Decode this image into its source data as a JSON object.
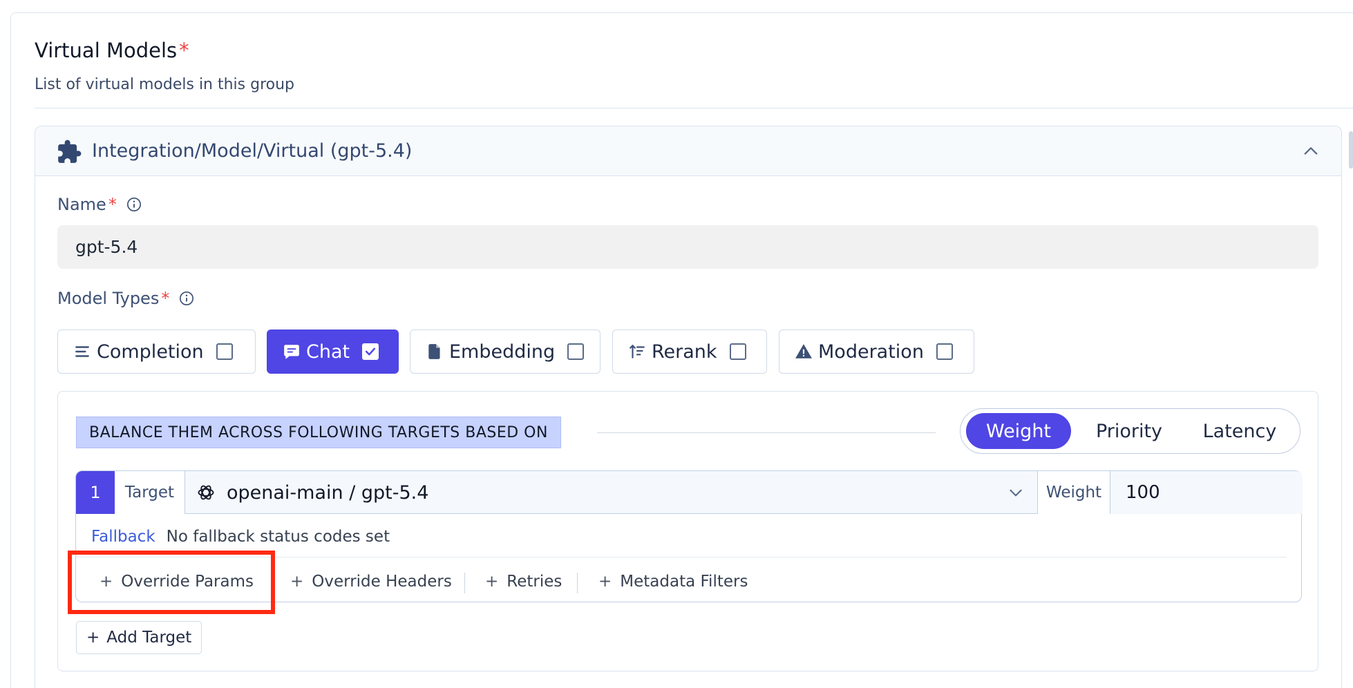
{
  "section": {
    "title": "Virtual Models",
    "required_mark": "*",
    "subtitle": "List of virtual models in this group"
  },
  "accordion": {
    "title": "Integration/Model/Virtual (gpt-5.4)",
    "icon": "puzzle-icon",
    "toggle_icon": "chevron-up-icon"
  },
  "name_field": {
    "label": "Name",
    "required_mark": "*",
    "value": "gpt-5.4"
  },
  "model_types": {
    "label": "Model Types",
    "required_mark": "*",
    "options": [
      {
        "label": "Completion",
        "icon": "lines-icon",
        "checked": false
      },
      {
        "label": "Chat",
        "icon": "chat-icon",
        "checked": true
      },
      {
        "label": "Embedding",
        "icon": "document-icon",
        "checked": false
      },
      {
        "label": "Rerank",
        "icon": "sort-icon",
        "checked": false
      },
      {
        "label": "Moderation",
        "icon": "warning-icon",
        "checked": false
      }
    ]
  },
  "balance": {
    "label": "BALANCE THEM ACROSS FOLLOWING TARGETS BASED ON",
    "strategies": [
      "Weight",
      "Priority",
      "Latency"
    ],
    "selected": "Weight"
  },
  "target": {
    "index": "1",
    "tag": "Target",
    "model": "openai-main / gpt-5.4",
    "weight_label": "Weight",
    "weight_value": "100",
    "fallback_label": "Fallback",
    "fallback_text": "No fallback status codes set",
    "actions": [
      "Override Params",
      "Override Headers",
      "Retries",
      "Metadata Filters"
    ]
  },
  "add_target_label": "Add Target",
  "colors": {
    "accent": "#4f46e5",
    "highlight": "#ff2a12",
    "balance_badge": "#c7d2fe"
  }
}
